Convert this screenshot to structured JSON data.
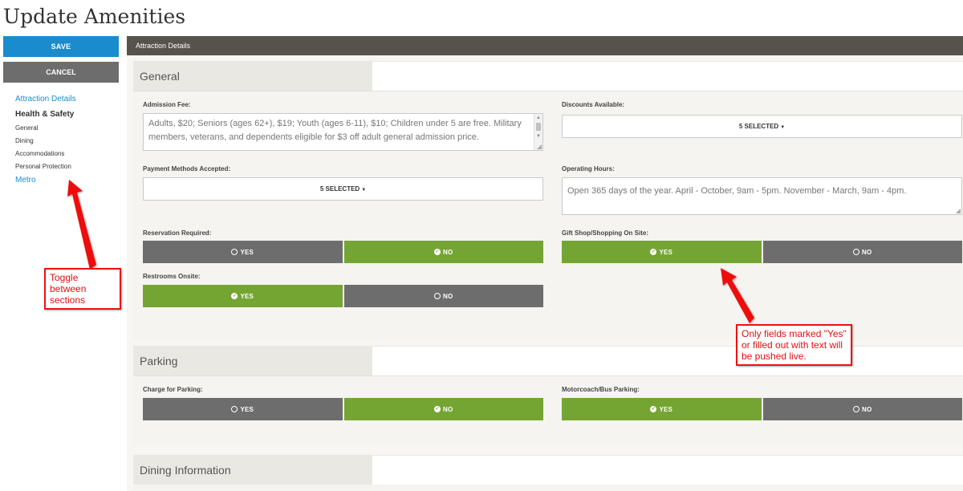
{
  "page": {
    "title": "Update Amenities"
  },
  "sidebar": {
    "save_label": "SAVE",
    "cancel_label": "CANCEL",
    "nav": {
      "attraction_details": "Attraction Details",
      "health_safety": "Health & Safety",
      "sub": [
        "General",
        "Dining",
        "Accommodations",
        "Personal Protection"
      ],
      "metro": "Metro"
    }
  },
  "main": {
    "header": "Attraction Details"
  },
  "general": {
    "title": "General",
    "admission_fee_label": "Admission Fee:",
    "admission_fee_value": "Adults, $20; Seniors (ages 62+), $19; Youth (ages 6-11), $10; Children under 5 are free. Military members, veterans, and dependents eligible for $3 off adult general admission price.",
    "discounts_label": "Discounts Available:",
    "discounts_value": "5 SELECTED",
    "payment_label": "Payment Methods Accepted:",
    "payment_value": "5 SELECTED",
    "hours_label": "Operating Hours:",
    "hours_value": "Open 365 days of the year. April - October, 9am - 5pm. November - March, 9am - 4pm.",
    "reservation_label": "Reservation Required:",
    "giftshop_label": "Gift Shop/Shopping On Site:",
    "restrooms_label": "Restrooms Onsite:"
  },
  "parking": {
    "title": "Parking",
    "charge_label": "Charge for Parking:",
    "bus_label": "Motorcoach/Bus Parking:"
  },
  "dining": {
    "title": "Dining Information"
  },
  "toggle": {
    "yes": "YES",
    "no": "NO"
  },
  "annotations": {
    "toggle_note": "Toggle between sections",
    "fields_note": "Only fields marked \"Yes\" or filled out with text will be pushed live."
  },
  "colors": {
    "save_blue": "#1a8ccd",
    "header_brown": "#58524c",
    "on_green": "#74a532",
    "off_gray": "#6d6d6d",
    "annotation_red": "#e11"
  },
  "state": {
    "reservation_required": "NO",
    "gift_shop": "YES",
    "restrooms": "YES",
    "charge_for_parking": "NO",
    "bus_parking": "YES"
  }
}
